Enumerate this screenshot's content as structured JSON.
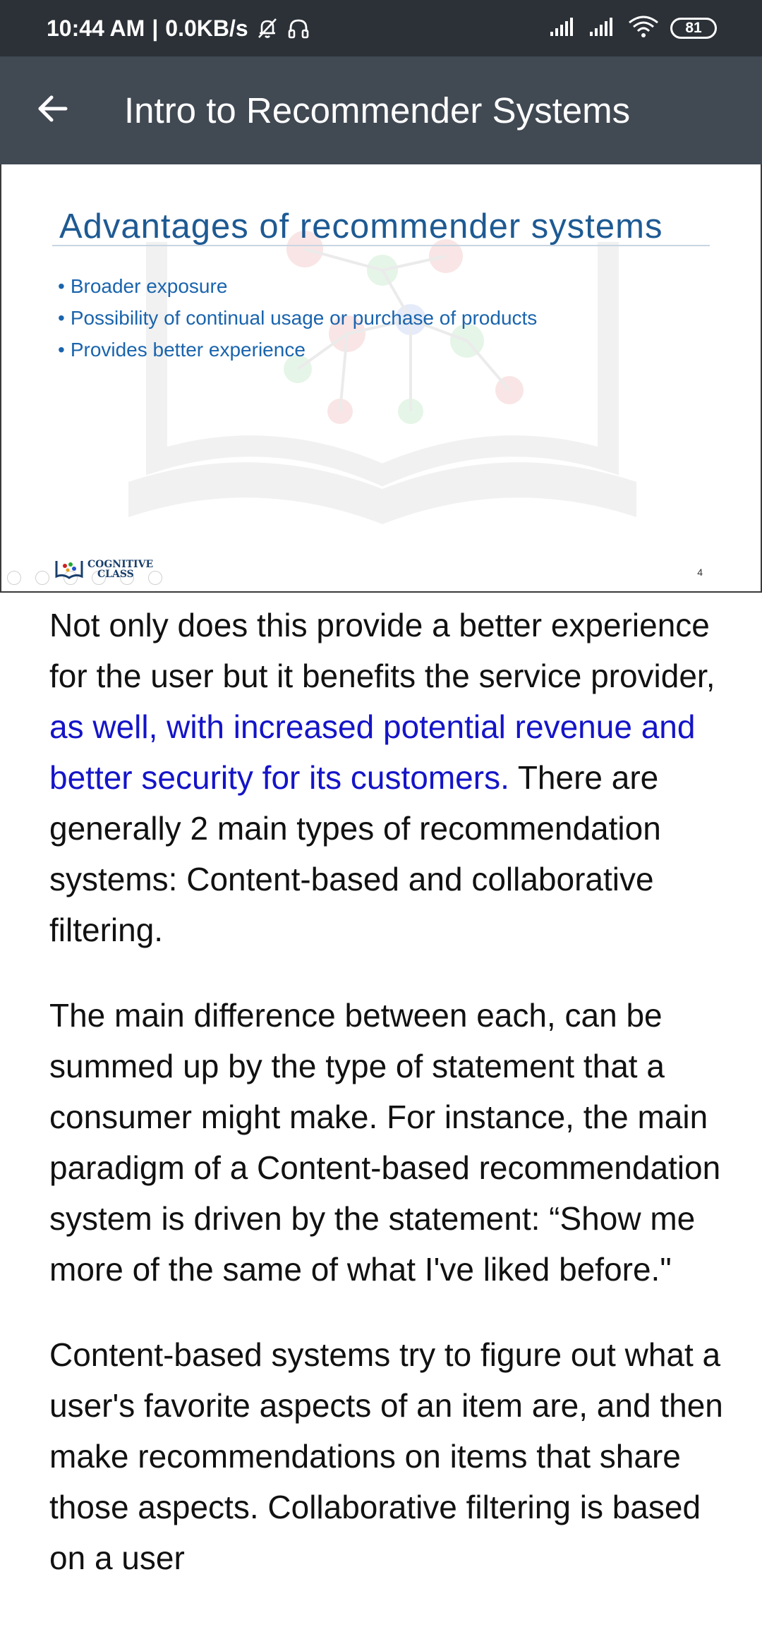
{
  "status_bar": {
    "time": "10:44 AM",
    "separator": "|",
    "speed": "0.0KB/s",
    "battery": "81",
    "icons": [
      "mute-icon",
      "headphones-icon",
      "signal-icon",
      "signal-icon",
      "wifi-icon",
      "battery-icon"
    ]
  },
  "app_bar": {
    "back_icon": "back-arrow-icon",
    "title": "Intro to Recommender Systems"
  },
  "slide": {
    "title": "Advantages of recommender systems",
    "bullets": [
      "Broader exposure",
      "Possibility of continual usage or purchase of products",
      "Provides better experience"
    ],
    "bullet_char": "•",
    "logo_line1": "COGNITIVE",
    "logo_line2": "CLASS",
    "page_number": "4"
  },
  "article": {
    "p1_before": "Not only does this provide a better experience for the user but it benefits the service provider, ",
    "p1_link": "as well, with increased potential revenue and better security for its customers.",
    "p1_after": " There are generally 2 main types of recommendation systems: Content-based and collaborative filtering.",
    "p2": "The main difference between each, can be summed up by the type of statement that a consumer might make.  For instance, the main paradigm of a Content-based recommendation system is driven by the statement: “Show me more of the same of what I've liked before.\"",
    "p3": "Content-based systems try to figure out what a user's favorite aspects of an item are, and then make recommendations on items that share those aspects. Collaborative filtering is based on a user"
  },
  "colors": {
    "status_bar_bg": "#2c3138",
    "app_bar_bg": "#414953",
    "slide_title": "#1e5a93",
    "slide_bullets": "#1a64ad",
    "link": "#1414c8",
    "body_text": "#111111"
  }
}
